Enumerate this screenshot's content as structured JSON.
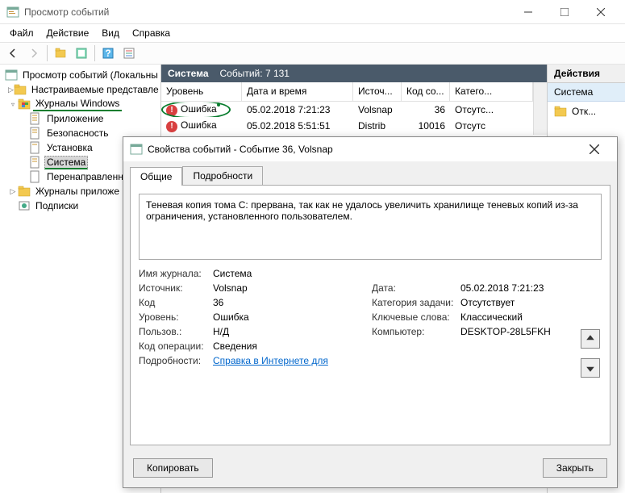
{
  "window": {
    "title": "Просмотр событий"
  },
  "menu": {
    "file": "Файл",
    "action": "Действие",
    "view": "Вид",
    "help": "Справка"
  },
  "tree": {
    "root": "Просмотр событий (Локальны",
    "custom": "Настраиваемые представле",
    "winlogs": "Журналы Windows",
    "app": "Приложение",
    "security": "Безопасность",
    "setup": "Установка",
    "system": "Система",
    "forwarded": "Перенаправленные событ",
    "applogs": "Журналы приложе",
    "subs": "Подписки"
  },
  "list": {
    "header_name": "Система",
    "header_count_label": "Событий:",
    "header_count": "7 131",
    "cols": {
      "level": "Уровень",
      "datetime": "Дата и время",
      "source": "Источ...",
      "code": "Код со...",
      "cat": "Катего..."
    },
    "rows": [
      {
        "level": "Ошибка",
        "dt": "05.02.2018 7:21:23",
        "src": "Volsnap",
        "code": "36",
        "cat": "Отсутс..."
      },
      {
        "level": "Ошибка",
        "dt": "05.02.2018 5:51:51",
        "src": "Distrib",
        "code": "10016",
        "cat": "Отсутс"
      }
    ]
  },
  "actions": {
    "title": "Действия",
    "system": "Система",
    "open": "Отк..."
  },
  "dialog": {
    "title": "Свойства событий - Событие 36, Volsnap",
    "tab_general": "Общие",
    "tab_details": "Подробности",
    "message": "Теневая копия тома C: прервана, так как не удалось увеличить хранилище теневых копий из-за ограничения, установленного пользователем.",
    "labels": {
      "log": "Имя журнала:",
      "source": "Источник:",
      "code": "Код",
      "level": "Уровень:",
      "user": "Пользов.:",
      "opcode": "Код операции:",
      "details": "Подробности:",
      "date": "Дата:",
      "taskcat": "Категория задачи:",
      "keywords": "Ключевые слова:",
      "computer": "Компьютер:"
    },
    "values": {
      "log": "Система",
      "source": "Volsnap",
      "code": "36",
      "level": "Ошибка",
      "user": "Н/Д",
      "opcode": "Сведения",
      "details_link": "Справка в Интернете для",
      "date": "05.02.2018 7:21:23",
      "taskcat": "Отсутствует",
      "keywords": "Классический",
      "computer": "DESKTOP-28L5FKH"
    },
    "copy": "Копировать",
    "close": "Закрыть"
  }
}
